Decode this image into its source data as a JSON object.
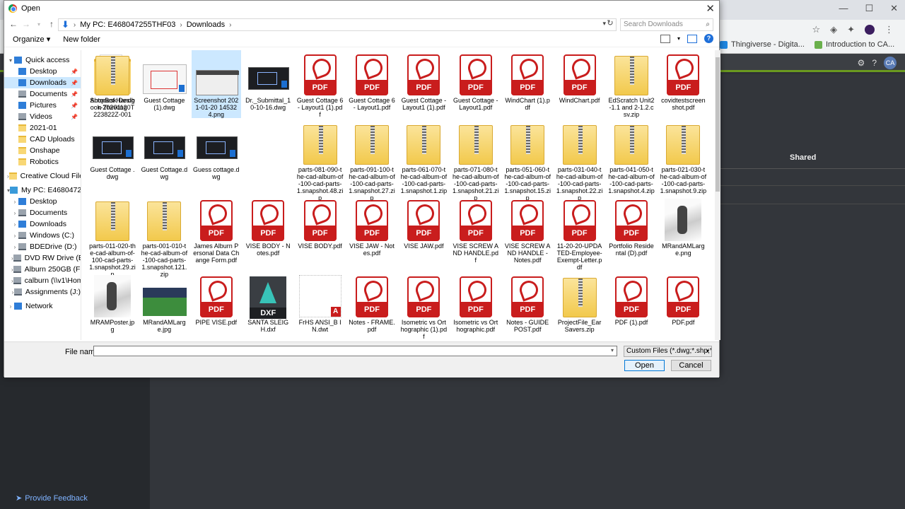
{
  "background": {
    "bookmarks": [
      "Thingiverse - Digita...",
      "Introduction to CA..."
    ],
    "shared_header": "Shared",
    "avatar_initials": "CA",
    "feedback": "Provide Feedback"
  },
  "dialog": {
    "title": "Open",
    "breadcrumb": [
      "My PC: E468047255THF03",
      "Downloads"
    ],
    "search_placeholder": "Search Downloads",
    "organize": "Organize ▾",
    "new_folder": "New folder"
  },
  "navpane": [
    {
      "label": "Quick access",
      "icon": "star-icon",
      "level": 0,
      "tw": "▾"
    },
    {
      "label": "Desktop",
      "icon": "desktop-icon",
      "level": 1,
      "pin": true
    },
    {
      "label": "Downloads",
      "icon": "download-icon",
      "level": 1,
      "pin": true,
      "selected": true
    },
    {
      "label": "Documents",
      "icon": "documents-icon",
      "level": 1,
      "pin": true
    },
    {
      "label": "Pictures",
      "icon": "pictures-icon",
      "level": 1,
      "pin": true
    },
    {
      "label": "Videos",
      "icon": "videos-icon",
      "level": 1,
      "pin": true
    },
    {
      "label": "2021-01",
      "icon": "folder-icon",
      "level": 1
    },
    {
      "label": "CAD Uploads",
      "icon": "folder-icon",
      "level": 1
    },
    {
      "label": "Onshape",
      "icon": "folder-icon",
      "level": 1
    },
    {
      "label": "Robotics",
      "icon": "folder-icon",
      "level": 1
    },
    {
      "label": "Creative Cloud Files",
      "icon": "creative-cloud-icon",
      "level": 0,
      "tw": "›"
    },
    {
      "label": "My PC: E468047255T",
      "icon": "pc-icon",
      "level": 0,
      "tw": "▾"
    },
    {
      "label": "Desktop",
      "icon": "desktop-icon",
      "level": 1,
      "tw": "›"
    },
    {
      "label": "Documents",
      "icon": "documents-icon",
      "level": 1,
      "tw": "›"
    },
    {
      "label": "Downloads",
      "icon": "download-icon",
      "level": 1,
      "tw": "›"
    },
    {
      "label": "Windows (C:)",
      "icon": "drive-icon",
      "level": 1,
      "tw": "›"
    },
    {
      "label": "BDEDrive (D:)",
      "icon": "drive-icon",
      "level": 1,
      "tw": "›"
    },
    {
      "label": "DVD RW Drive (E:) C",
      "icon": "dvd-icon",
      "level": 1,
      "tw": "›"
    },
    {
      "label": "Alburn 250GB (F:)",
      "icon": "drive-icon",
      "level": 1,
      "tw": "›"
    },
    {
      "label": "calburn (\\\\v1\\Hom",
      "icon": "network-drive-icon",
      "level": 1,
      "tw": "›"
    },
    {
      "label": "Assignments (J:)",
      "icon": "network-drive-icon",
      "level": 1,
      "tw": "›"
    },
    {
      "label": "Network",
      "icon": "network-icon",
      "level": 0,
      "tw": "›"
    }
  ],
  "files": [
    {
      "name": "Autodesk Design Thinking",
      "kind": "folder"
    },
    {
      "name": "Guest Cottage (1).dwg",
      "kind": "dwg-light"
    },
    {
      "name": "Screenshot 2021-01-20 145324.png",
      "kind": "png",
      "selected": true
    },
    {
      "name": "Dr._Submittal_10-10-16.dwg",
      "kind": "dwg-dark"
    },
    {
      "name": "Guest Cottage 6 - Layout1 (1).pdf",
      "kind": "pdf"
    },
    {
      "name": "Guest Cottage 6 - Layout1.pdf",
      "kind": "pdf"
    },
    {
      "name": "Guest Cottage - Layout1 (1).pdf",
      "kind": "pdf"
    },
    {
      "name": "Guest Cottage - Layout1.pdf",
      "kind": "pdf"
    },
    {
      "name": "WindChart (1).pdf",
      "kind": "pdf"
    },
    {
      "name": "WindChart.pdf",
      "kind": "pdf"
    },
    {
      "name": "EdScratch Unit2-1.1 and 2-1.2.csv.zip",
      "kind": "zip"
    },
    {
      "name": "covidtestscreenshot.pdf",
      "kind": "pdf"
    },
    {
      "name": "Guest Cottage .dwg",
      "kind": "dwg-dark"
    },
    {
      "name": "Guest Cottage.dwg",
      "kind": "dwg-dark"
    },
    {
      "name": "Guess cottage.dwg",
      "kind": "dwg-dark"
    },
    {
      "name": "",
      "kind": "empty"
    },
    {
      "name": "parts-081-090-the-cad-album-of-100-cad-parts-1.snapshot.48.zip",
      "kind": "zip"
    },
    {
      "name": "parts-091-100-the-cad-album-of-100-cad-parts-1.snapshot.27.zip",
      "kind": "zip"
    },
    {
      "name": "parts-061-070-the-cad-album-of-100-cad-parts-1.snapshot.1.zip",
      "kind": "zip"
    },
    {
      "name": "parts-071-080-the-cad-album-of-100-cad-parts-1.snapshot.21.zip",
      "kind": "zip"
    },
    {
      "name": "parts-051-060-the-cad-album-of-100-cad-parts-1.snapshot.15.zip",
      "kind": "zip"
    },
    {
      "name": "parts-031-040-the-cad-album-of-100-cad-parts-1.snapshot.22.zip",
      "kind": "zip"
    },
    {
      "name": "parts-041-050-the-cad-album-of-100-cad-parts-1.snapshot.4.zip",
      "kind": "zip"
    },
    {
      "name": "parts-021-030-the-cad-album-of-100-cad-parts-1.snapshot.9.zip",
      "kind": "zip"
    },
    {
      "name": "parts-011-020-the-cad-album-of-100-cad-parts-1.snapshot.29.zip",
      "kind": "zip"
    },
    {
      "name": "parts-001-010-the-cad-album-of-100-cad-parts-1.snapshot.121.zip",
      "kind": "zip"
    },
    {
      "name": "James Alburn Personal Data Change Form.pdf",
      "kind": "pdf"
    },
    {
      "name": "VISE BODY - Notes.pdf",
      "kind": "pdf"
    },
    {
      "name": "VISE BODY.pdf",
      "kind": "pdf"
    },
    {
      "name": "VISE JAW - Notes.pdf",
      "kind": "pdf"
    },
    {
      "name": "VISE JAW.pdf",
      "kind": "pdf"
    },
    {
      "name": "VISE SCREW AND HANDLE.pdf",
      "kind": "pdf"
    },
    {
      "name": "VISE SCREW AND HANDLE - Notes.pdf",
      "kind": "pdf"
    },
    {
      "name": "11-20-20-UPDATED-Employee-Exempt-Letter.pdf",
      "kind": "pdf"
    },
    {
      "name": "Portfolio Residental (D).pdf",
      "kind": "pdf"
    },
    {
      "name": "MRandAMLarge.png",
      "kind": "photo-w"
    },
    {
      "name": "MRAMPoster.jpg",
      "kind": "photo-w"
    },
    {
      "name": "MRandAMLarge.jpg",
      "kind": "photo-g"
    },
    {
      "name": "PIPE VISE.pdf",
      "kind": "pdf"
    },
    {
      "name": "SANTA SLEIGH.dxf",
      "kind": "dxf"
    },
    {
      "name": "FrHS ANSI_B IN.dwt",
      "kind": "dwt"
    },
    {
      "name": "Notes - FRAME.pdf",
      "kind": "pdf"
    },
    {
      "name": "Isometric vs Orthographic (1).pdf",
      "kind": "pdf"
    },
    {
      "name": "Isometric vs Orthographic.pdf",
      "kind": "pdf"
    },
    {
      "name": "Notes - GUIDE POST.pdf",
      "kind": "pdf"
    },
    {
      "name": "ProjectFile_EarSavers.zip",
      "kind": "zip"
    },
    {
      "name": "PDF (1).pdf",
      "kind": "pdf"
    },
    {
      "name": "PDF.pdf",
      "kind": "pdf"
    },
    {
      "name": "ShopBot Handbook-20201120T223822Z-001",
      "kind": "zip"
    }
  ],
  "bottom": {
    "file_name_label": "File name:",
    "file_name_value": "",
    "filter": "Custom Files (*.dwg;*.shp;*.sdf,",
    "open": "Open",
    "cancel": "Cancel"
  },
  "pdf_badge": "PDF",
  "dxf_badge": "DXF"
}
